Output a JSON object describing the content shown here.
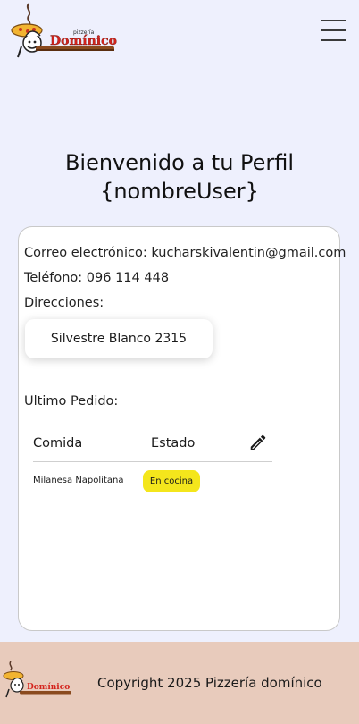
{
  "header": {
    "logo_small_text": "pizzería",
    "logo_text": "Domínico",
    "menu_icon": "hamburger-menu-icon"
  },
  "profile": {
    "title_line1": "Bienvenido a tu Perfil",
    "title_line2": "{nombreUser}",
    "email_line": "Correo electrónico: kucharskivalentin@gmail.com",
    "phone_line": "Teléfono: 096 114 448",
    "addresses_label": "Direcciones:",
    "addresses": [
      "Silvestre Blanco 2315"
    ],
    "last_order_label": "Ultimo Pedido:"
  },
  "order_table": {
    "headers": [
      "Comida",
      "Estado"
    ],
    "edit_icon": "pencil-edit-icon",
    "rows": [
      {
        "food": "Milanesa Napolitana",
        "status": "En cocina"
      }
    ],
    "status_color": "#f4e61c"
  },
  "footer": {
    "copyright": "Copyright 2025 Pizzería domínico",
    "background": "#e8cbbc"
  },
  "colors": {
    "page_background": "#eef0fd",
    "brand_red": "#d4231c"
  }
}
